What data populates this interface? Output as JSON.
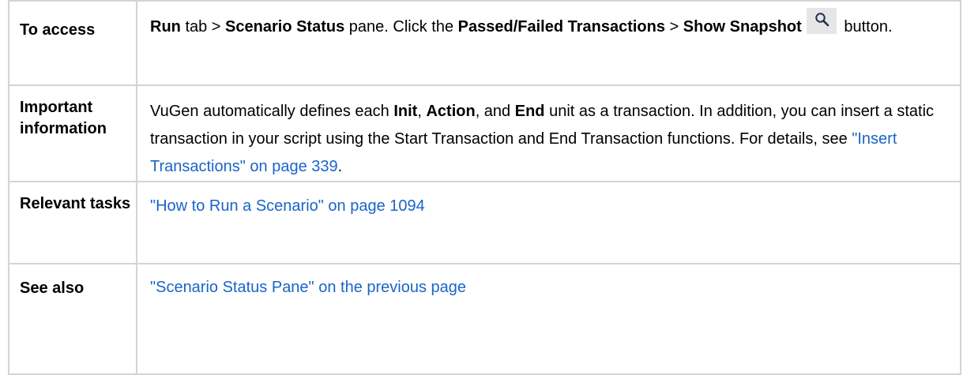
{
  "rows": [
    {
      "label": "To access",
      "content": {
        "t1": "Run",
        "t2": " tab > ",
        "t3": "Scenario Status",
        "t4": " pane. Click the ",
        "t5": "Passed/Failed Transactions",
        "t6": " > ",
        "t7": "Show Snapshot",
        "t8": " button.",
        "icon": "magnifier-icon"
      }
    },
    {
      "label": "Important information",
      "content": {
        "t1": "VuGen automatically defines each ",
        "t2": "Init",
        "t3": ", ",
        "t4": "Action",
        "t5": ", and ",
        "t6": "End",
        "t7": " unit as a transaction. In addition, you can insert a static transaction in your script using the Start Transaction and End Transaction functions. For details, see ",
        "link": "\"Insert Transactions\" on page 339",
        "t8": "."
      }
    },
    {
      "label": "Relevant tasks",
      "content": {
        "link": "\"How to Run a Scenario\" on page 1094"
      }
    },
    {
      "label": "See also",
      "content": {
        "link": "\"Scenario Status Pane\" on the previous page"
      }
    }
  ],
  "colors": {
    "link": "#1a64c8",
    "border": "#d4d4d4",
    "button_bg": "#e6e6e6"
  }
}
